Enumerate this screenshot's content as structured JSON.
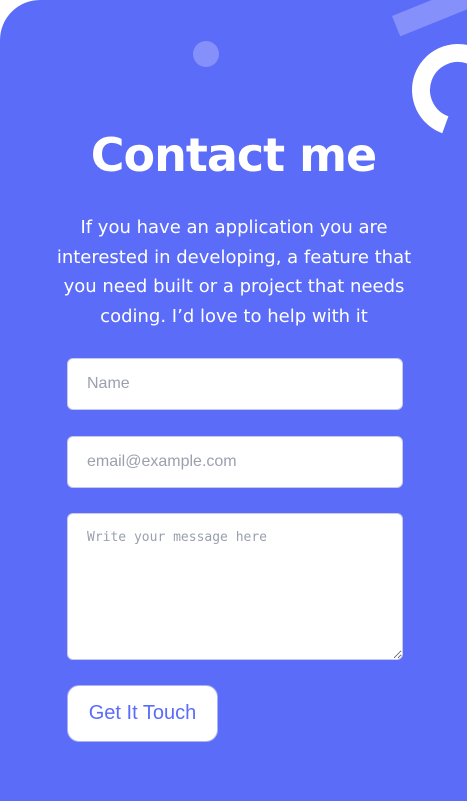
{
  "colors": {
    "background": "#5b6cf9",
    "decoration": "#8590fb",
    "text": "#ffffff",
    "button_text": "#5b6cf9"
  },
  "contact": {
    "title": "Contact me",
    "description_lines": [
      "If you have an application you are",
      "interested in developing, a feature that",
      "you need built or a project that needs",
      "coding. I’d love to help with it"
    ],
    "form": {
      "name_placeholder": "Name",
      "email_placeholder": "email@example.com",
      "message_placeholder": "Write your message here",
      "submit_label": "Get It Touch"
    }
  }
}
